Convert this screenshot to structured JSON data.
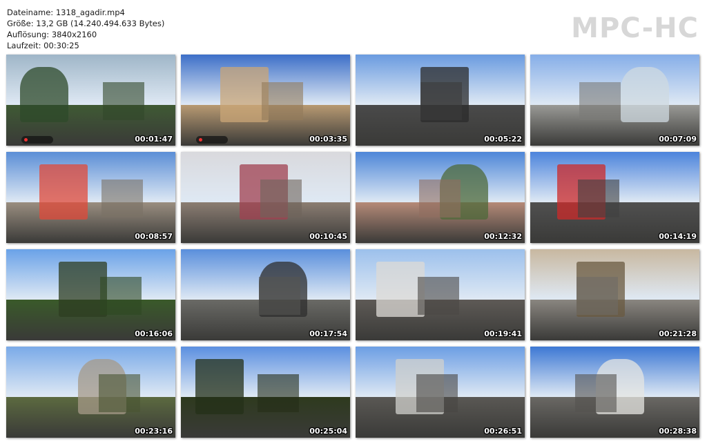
{
  "file_info": {
    "filename": "Dateiname: 1318_agadir.mp4",
    "size": "Größe: 13,2 GB (14.240.494.633 Bytes)",
    "resolution": "Auflösung: 3840x2160",
    "duration": "Laufzeit: 00:30:25"
  },
  "logo": "MPC-HC",
  "thumbnails": [
    {
      "time": "00:01:47",
      "sky": "#9fb6c8",
      "ground": "#3f5a34",
      "accent": "#2e4a2a"
    },
    {
      "time": "00:03:35",
      "sky": "#3d6fc8",
      "ground": "#b89a72",
      "accent": "#c9a577"
    },
    {
      "time": "00:05:22",
      "sky": "#6a9be0",
      "ground": "#4a4a4a",
      "accent": "#2b2b2b"
    },
    {
      "time": "00:07:09",
      "sky": "#86aee8",
      "ground": "#9a9a96",
      "accent": "#cfd9e0"
    },
    {
      "time": "00:08:57",
      "sky": "#5b8ed6",
      "ground": "#9a8e80",
      "accent": "#e04a3a"
    },
    {
      "time": "00:10:45",
      "sky": "#d9d9dd",
      "ground": "#8b7d72",
      "accent": "#a04050"
    },
    {
      "time": "00:12:32",
      "sky": "#4d86d8",
      "ground": "#b58a78",
      "accent": "#4d6a3a"
    },
    {
      "time": "00:14:19",
      "sky": "#4c84dc",
      "ground": "#505050",
      "accent": "#cc2a2a"
    },
    {
      "time": "00:16:06",
      "sky": "#6aa2e8",
      "ground": "#3a5a2a",
      "accent": "#2d3d22"
    },
    {
      "time": "00:17:54",
      "sky": "#5a8fdc",
      "ground": "#6a6a66",
      "accent": "#2e2e2e"
    },
    {
      "time": "00:19:41",
      "sky": "#9cc0ec",
      "ground": "#5e5a56",
      "accent": "#dcdad6"
    },
    {
      "time": "00:21:28",
      "sky": "#c8b8a0",
      "ground": "#8a8680",
      "accent": "#6a5a40"
    },
    {
      "time": "00:23:16",
      "sky": "#7aaae8",
      "ground": "#5c6a40",
      "accent": "#a59a88"
    },
    {
      "time": "00:25:04",
      "sky": "#5b8fe0",
      "ground": "#2e3a1e",
      "accent": "#243018"
    },
    {
      "time": "00:26:51",
      "sky": "#6c9ee4",
      "ground": "#5a5854",
      "accent": "#d0d0cc"
    },
    {
      "time": "00:28:38",
      "sky": "#3d78d4",
      "ground": "#6a6864",
      "accent": "#e6e6e2"
    }
  ],
  "icons": {
    "recording_badge": "record-badge-icon"
  }
}
